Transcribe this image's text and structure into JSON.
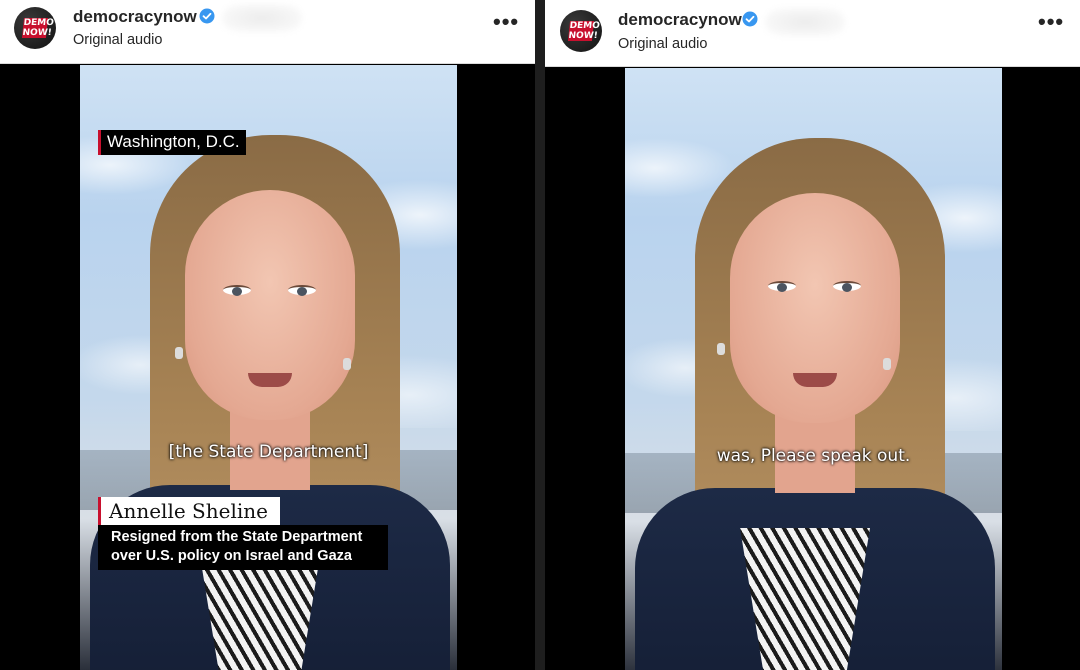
{
  "posts": [
    {
      "username": "democracynow",
      "audio_label": "Original audio",
      "logo_text": "DEMOCRACY NOW!",
      "more_label": "•••",
      "location": "Washington, D.C.",
      "caption": "[the State Department]",
      "lower_third": {
        "name": "Annelle Sheline",
        "description": "Resigned from the State Department over U.S. policy on Israel and Gaza"
      }
    },
    {
      "username": "democracynow",
      "audio_label": "Original audio",
      "logo_text": "DEMOCRACY NOW!",
      "more_label": "•••",
      "caption": "was, Please speak out."
    }
  ],
  "colors": {
    "verified_badge": "#3897f0",
    "brand_red": "#c8102e",
    "header_bg": "#ffffff",
    "video_bg": "#000000"
  },
  "icons": [
    "avatar-logo",
    "verified-badge-icon",
    "more-options-icon"
  ]
}
